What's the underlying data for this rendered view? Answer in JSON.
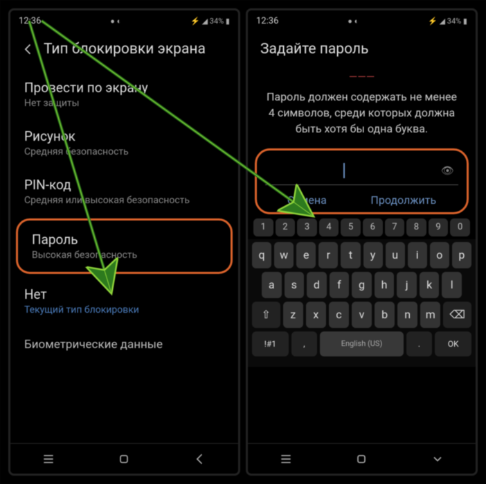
{
  "status": {
    "time": "12:36",
    "icons_text": "● ◐",
    "right_text": "⚡ ◢ 34% ▮"
  },
  "left": {
    "title": "Тип блокировки экрана",
    "items": [
      {
        "title": "Провести по экрану",
        "sub": "Нет защиты"
      },
      {
        "title": "Рисунок",
        "sub": "Средняя безопасность"
      },
      {
        "title": "PIN-код",
        "sub": "Средняя или высокая безопасность"
      }
    ],
    "highlight": {
      "title": "Пароль",
      "sub": "Высокая безопасность"
    },
    "after": {
      "title": "Нет",
      "sub": "Текущий тип блокировки"
    },
    "section": "Биометрические данные"
  },
  "right": {
    "title": "Задайте пароль",
    "hint_red": "———",
    "hint": "Пароль должен содержать не менее 4 символов, среди которых должна быть хотя бы одна буква.",
    "cancel": "Отмена",
    "continue": "Продолжить",
    "numrow": [
      "1",
      "2",
      "3",
      "4",
      "5",
      "6",
      "7",
      "8",
      "9",
      "0"
    ],
    "row1": [
      "q",
      "w",
      "e",
      "r",
      "t",
      "y",
      "u",
      "i",
      "o",
      "p"
    ],
    "row2": [
      "a",
      "s",
      "d",
      "f",
      "g",
      "h",
      "j",
      "k",
      "l"
    ],
    "row3_shift": "⇧",
    "row3": [
      "z",
      "x",
      "c",
      "v",
      "b",
      "n",
      "m"
    ],
    "row3_bksp": "⌫",
    "row4": {
      "num": "!#1",
      "lang": "English (US)",
      "dot": ".",
      "ok": "OK"
    }
  }
}
